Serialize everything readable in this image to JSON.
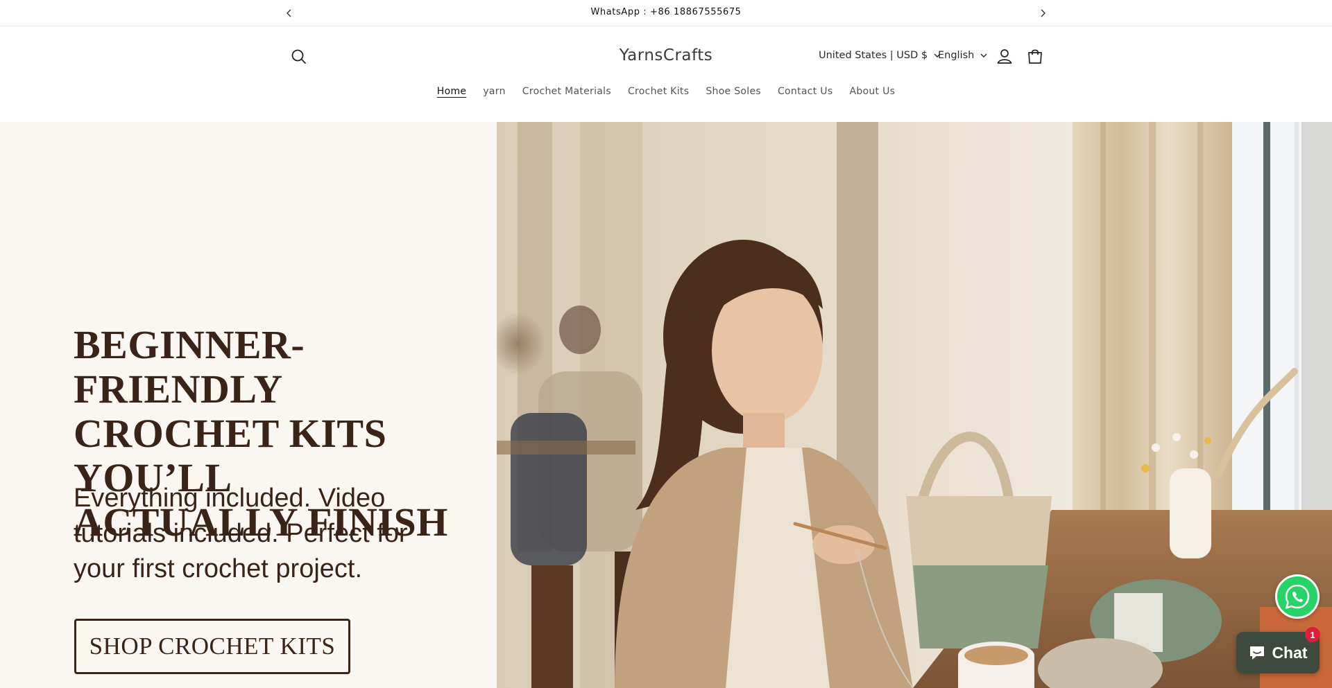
{
  "announcement": {
    "text": "WhatsApp : +86 18867555675"
  },
  "header": {
    "logo": "YarnsCrafts",
    "country_selector": "United States | USD $",
    "language_selector": "English"
  },
  "nav": {
    "items": [
      {
        "label": "Home",
        "active": true
      },
      {
        "label": "yarn",
        "active": false
      },
      {
        "label": "Crochet Materials",
        "active": false
      },
      {
        "label": "Crochet Kits",
        "active": false
      },
      {
        "label": "Shoe Soles",
        "active": false
      },
      {
        "label": "Contact Us",
        "active": false
      },
      {
        "label": "About Us",
        "active": false
      }
    ]
  },
  "hero": {
    "title_lines": [
      "BEGINNER-FRIENDLY",
      "CROCHET KITS YOU’LL",
      "ACTUALLY FINISH"
    ],
    "subtitle_lines": [
      "Everything included. Video",
      "tutorials included. Perfect for",
      "your first crochet project."
    ],
    "cta_label": "SHOP CROCHET KITS",
    "background_left": "#faf7f2",
    "text_color": "#3a2418"
  },
  "widgets": {
    "chat_label": "Chat",
    "chat_badge": "1",
    "whatsapp_color": "#25d366",
    "chat_color": "#3d4a3d",
    "badge_color": "#e01e3c"
  },
  "icons": [
    "chevron-left-icon",
    "chevron-right-icon",
    "search-icon",
    "chevron-down-icon",
    "account-icon",
    "cart-icon",
    "whatsapp-icon",
    "chat-bubble-icon"
  ]
}
